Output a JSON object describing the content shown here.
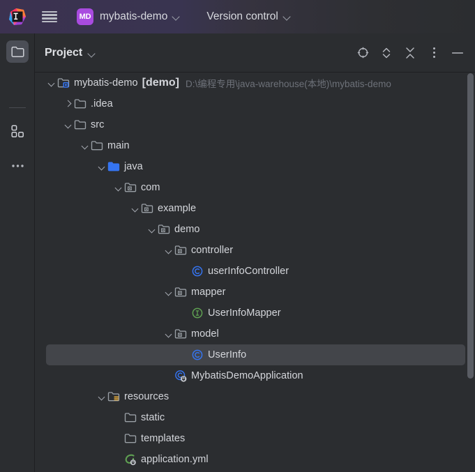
{
  "titlebar": {
    "logo_icon": "intellij-idea-logo",
    "menu_icon": "hamburger-menu-icon",
    "project_badge": "MD",
    "project_name": "mybatis-demo",
    "project_chevron_icon": "chevron-down-icon",
    "version_control_label": "Version control",
    "version_control_chevron_icon": "chevron-down-icon"
  },
  "rail": {
    "items": [
      {
        "icon": "project-folder-icon",
        "active": true
      },
      {
        "icon": "commit-structure-icon",
        "active": false
      },
      {
        "icon": "more-dots-icon",
        "active": false
      }
    ]
  },
  "panel": {
    "title": "Project",
    "title_chevron_icon": "chevron-down-icon",
    "tools": [
      {
        "icon": "select-opened-file-icon",
        "name": "select-opened-file-button"
      },
      {
        "icon": "expand-collapse-icon",
        "name": "expand-collapse-button"
      },
      {
        "icon": "collapse-all-icon",
        "name": "collapse-all-button"
      },
      {
        "icon": "more-options-icon",
        "name": "more-options-button"
      },
      {
        "icon": "minimize-icon",
        "name": "minimize-button"
      }
    ]
  },
  "tree": {
    "rows": [
      {
        "name": "mybatis-demo",
        "suffix": "[demo]",
        "path": "D:\\编程专用\\java-warehouse(本地)\\mybatis-demo",
        "depth": 0,
        "arrow": "down",
        "icon": "module-folder-icon",
        "selected": false
      },
      {
        "name": ".idea",
        "depth": 1,
        "arrow": "right",
        "icon": "folder-icon",
        "selected": false
      },
      {
        "name": "src",
        "depth": 1,
        "arrow": "down",
        "icon": "folder-icon",
        "selected": false
      },
      {
        "name": "main",
        "depth": 2,
        "arrow": "down",
        "icon": "folder-icon",
        "selected": false
      },
      {
        "name": "java",
        "depth": 3,
        "arrow": "down",
        "icon": "source-root-folder-icon",
        "selected": false
      },
      {
        "name": "com",
        "depth": 4,
        "arrow": "down",
        "icon": "package-folder-icon",
        "selected": false
      },
      {
        "name": "example",
        "depth": 5,
        "arrow": "down",
        "icon": "package-folder-icon",
        "selected": false
      },
      {
        "name": "demo",
        "depth": 6,
        "arrow": "down",
        "icon": "package-folder-icon",
        "selected": false
      },
      {
        "name": "controller",
        "depth": 7,
        "arrow": "down",
        "icon": "package-folder-icon",
        "selected": false
      },
      {
        "name": "userInfoController",
        "depth": 8,
        "arrow": "none",
        "icon": "java-class-icon",
        "selected": false
      },
      {
        "name": "mapper",
        "depth": 7,
        "arrow": "down",
        "icon": "package-folder-icon",
        "selected": false
      },
      {
        "name": "UserInfoMapper",
        "depth": 8,
        "arrow": "none",
        "icon": "java-interface-icon",
        "selected": false
      },
      {
        "name": "model",
        "depth": 7,
        "arrow": "down",
        "icon": "package-folder-icon",
        "selected": false
      },
      {
        "name": "UserInfo",
        "depth": 8,
        "arrow": "none",
        "icon": "java-class-icon",
        "selected": true
      },
      {
        "name": "MybatisDemoApplication",
        "depth": 7,
        "arrow": "none",
        "icon": "runnable-class-icon",
        "selected": false
      },
      {
        "name": "resources",
        "depth": 3,
        "arrow": "down",
        "icon": "resource-root-folder-icon",
        "selected": false
      },
      {
        "name": "static",
        "depth": 4,
        "arrow": "none",
        "icon": "folder-icon",
        "selected": false
      },
      {
        "name": "templates",
        "depth": 4,
        "arrow": "none",
        "icon": "folder-icon",
        "selected": false
      },
      {
        "name": "application.yml",
        "depth": 4,
        "arrow": "none",
        "icon": "spring-yaml-icon",
        "selected": false
      }
    ]
  },
  "scrollbar": {
    "name": "vertical-scrollbar"
  },
  "colors": {
    "background": "#2b2d30",
    "selection": "#43454a",
    "text": "#d4d6db",
    "muted_text": "#6d7179",
    "accent_purple": "#a94be0",
    "class_blue": "#3574f0",
    "interface_green": "#5fa052",
    "folder_gray": "#9aa0a6",
    "source_blue": "#3574f0",
    "resource_yellow": "#d9a43b"
  }
}
